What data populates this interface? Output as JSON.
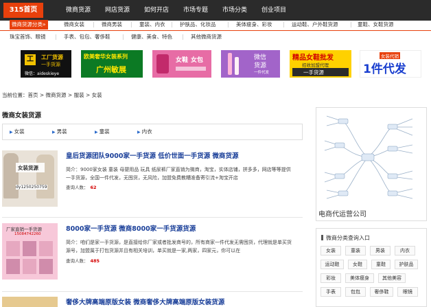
{
  "nav": {
    "logo": "315首页",
    "items": [
      "微商货源",
      "网店货源",
      "如何开店",
      "市场专题",
      "市场分类",
      "创业项目"
    ]
  },
  "categories": {
    "label": "微商货源分类»",
    "row1": [
      "微商女装",
      "微商男装",
      "童装、内衣",
      "护肤品、化妆品",
      "美体瘦身、彩妆",
      "运动鞋、户外鞋货源",
      "童鞋、女鞋货源"
    ],
    "row2": [
      "珠宝首饰、眼镜",
      "手表、包包、奢侈鞋",
      "健康、美食、特色",
      "其他微商货源"
    ]
  },
  "banners": {
    "b1": {
      "line1": "工厂货源",
      "line2": "一手货源",
      "line3": "微信：aideskieye"
    },
    "b2": {
      "line1": "欧美奢华女装系列",
      "line2": "广州敏展"
    },
    "b3": {
      "line1": "女鞋",
      "line2": "女包"
    },
    "b4": {
      "line1": "微信",
      "line2": "货源",
      "line3": "一件代发"
    },
    "b5": {
      "line1": "精品女鞋批发",
      "line2": "招收加盟代理",
      "line3": "一手货源"
    },
    "b6": {
      "line1": "女装代销",
      "line2": "1件代发"
    }
  },
  "breadcrumb": "当前位置：首页 > 微商货源 > 服装 > 女装",
  "section_title": "微商女装货源",
  "subnav": [
    "女装",
    "男装",
    "童装",
    "内衣"
  ],
  "listings": [
    {
      "title": "皇后货源团队9000家一手货源 低价世面一手货源 微商货源",
      "desc": "简介：9000家女装 童装 母婴用品 玩具 纸尿裤厂家直销为微商，淘宝，实体店铺，拼多多，网店等等提供一手货源，全国一件代发，无囤货，无风险，加盟免费教糟准备寄引流+淘宝开店",
      "views_label": "查询人数：",
      "views": "62",
      "thumb_text": "女装货源",
      "thumb_id": "dy1250250759"
    },
    {
      "title": "8000家一手货源 微商8000家一手货源货源",
      "desc": "简介：咱们是家一手货源，是直接给你厂家或者批发商号的，所有商家一件代发无需囤货，代理就是单买货源号，加盟属于打包货源并且有相关培训，单买就是一家,两家，四家元，你可以在",
      "views_label": "查询人数：",
      "views": "485",
      "thumb_text": "厂家直销一手货源",
      "thumb_id": "15084742260"
    },
    {
      "title": "奢侈大牌高端原版女装 微商奢侈大牌高端原版女装货源"
    }
  ],
  "side": {
    "card_caption": "电商代运营公司",
    "box_title": "微商分类查询入口",
    "tags": [
      "女装",
      "童装",
      "男装",
      "内衣",
      "运动鞋",
      "女鞋",
      "童鞋",
      "护肤品",
      "彩妆",
      "美体瘦身",
      "其他美容",
      "手表",
      "包包",
      "奢侈鞋",
      "眼镜"
    ]
  },
  "colors": {
    "accent": "#e8400c",
    "nav_bg": "#2b2b2b",
    "link": "#1a3f99",
    "count": "#d40000"
  }
}
